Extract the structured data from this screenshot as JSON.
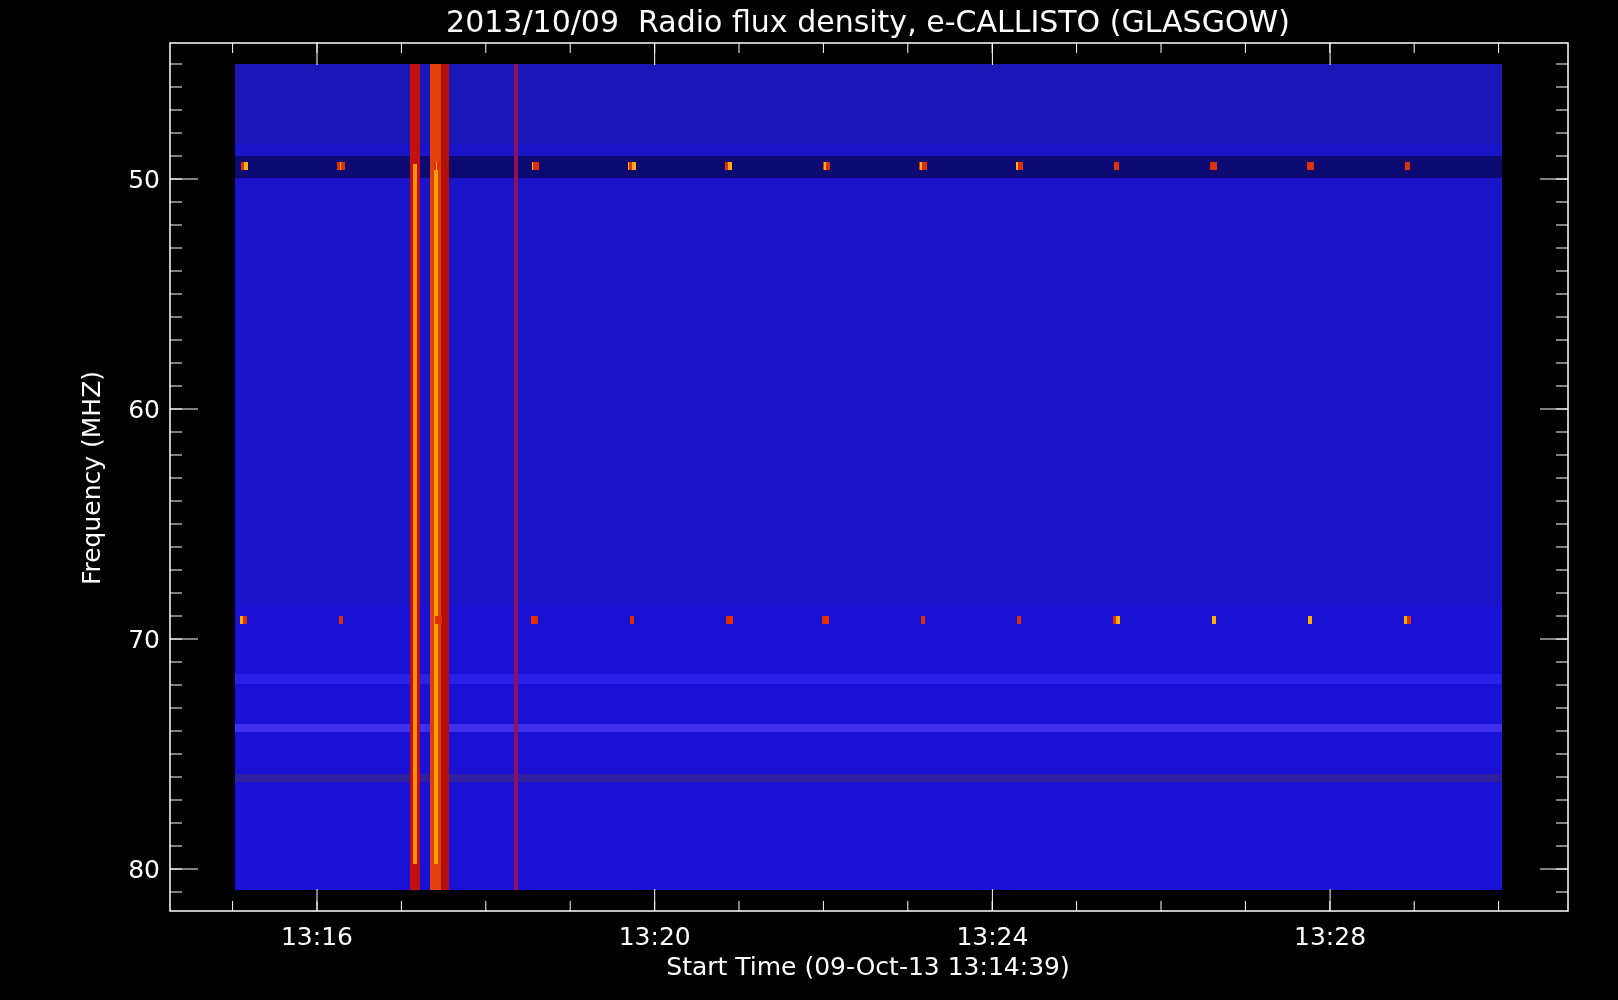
{
  "title": "2013/10/09  Radio flux density, e-CALLISTO (GLASGOW)",
  "xlabel": "Start Time (09-Oct-13 13:14:39)",
  "ylabel": "Frequency (MHZ)",
  "xticks": [
    "13:16",
    "13:20",
    "13:24",
    "13:28"
  ],
  "yticks": [
    "50",
    "60",
    "70",
    "80"
  ]
}
